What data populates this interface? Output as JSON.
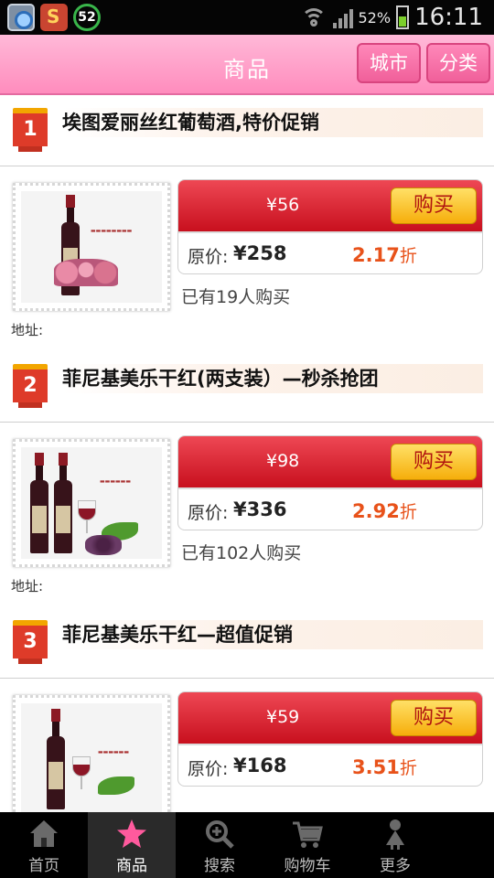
{
  "status_bar": {
    "app_badge_number": "52",
    "battery": "52%",
    "time": "16:11"
  },
  "header": {
    "title": "商品",
    "city_button": "城市",
    "category_button": "分类"
  },
  "products": [
    {
      "rank": "1",
      "title": "埃图爱丽丝红葡萄酒,特价促销",
      "price": "¥56",
      "buy_label": "购买",
      "original_label": "原价:",
      "original_price": "¥258",
      "discount": "2.17",
      "discount_unit": "折",
      "sold": "已有19人购买",
      "address_label": "地址:"
    },
    {
      "rank": "2",
      "title": "菲尼基美乐干红(两支装）—秒杀抢团",
      "price": "¥98",
      "buy_label": "购买",
      "original_label": "原价:",
      "original_price": "¥336",
      "discount": "2.92",
      "discount_unit": "折",
      "sold": "已有102人购买",
      "address_label": "地址:"
    },
    {
      "rank": "3",
      "title": "菲尼基美乐干红—超值促销",
      "price": "¥59",
      "buy_label": "购买",
      "original_label": "原价:",
      "original_price": "¥168",
      "discount": "3.51",
      "discount_unit": "折",
      "sold": "",
      "address_label": ""
    }
  ],
  "bottom_nav": [
    {
      "label": "首页",
      "icon": "home-icon",
      "active": false
    },
    {
      "label": "商品",
      "icon": "star-icon",
      "active": true
    },
    {
      "label": "搜索",
      "icon": "search-icon",
      "active": false
    },
    {
      "label": "购物车",
      "icon": "cart-icon",
      "active": false
    },
    {
      "label": "更多",
      "icon": "person-icon",
      "active": false
    }
  ],
  "colors": {
    "header_pink": "#ff8cbd",
    "price_red": "#c8101e",
    "buy_yellow": "#f6ae0b",
    "discount_orange": "#e8521a"
  }
}
